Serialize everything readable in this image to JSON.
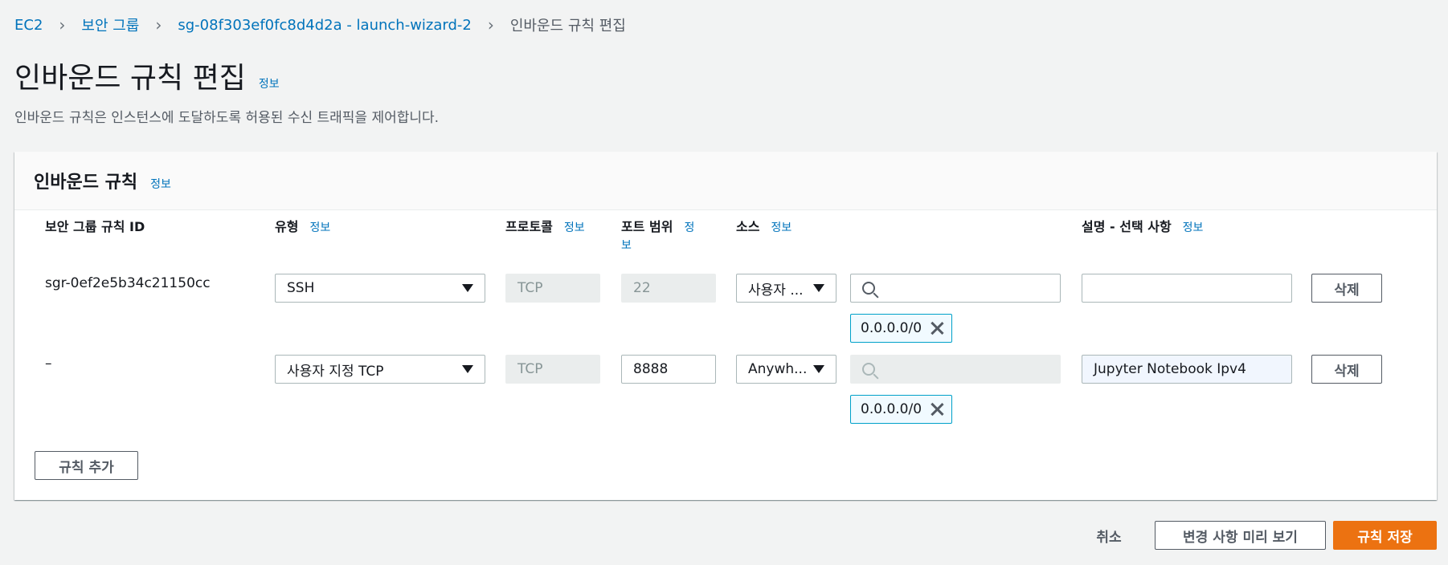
{
  "breadcrumb": {
    "items": [
      "EC2",
      "보안 그룹",
      "sg-08f303ef0fc8d4d2a - launch-wizard-2"
    ],
    "current": "인바운드 규칙 편집"
  },
  "page": {
    "title": "인바운드 규칙 편집",
    "info": "정보",
    "description": "인바운드 규칙은 인스턴스에 도달하도록 허용된 수신 트래픽을 제어합니다."
  },
  "panel": {
    "title": "인바운드 규칙",
    "info": "정보",
    "columns": {
      "rule_id": "보안 그룹 규칙 ID",
      "type": "유형",
      "protocol": "프로토콜",
      "port_range": "포트 범위",
      "port_range_info_1": "정",
      "port_range_info_2": "보",
      "source": "소스",
      "description": "설명 - 선택 사항",
      "info": "정보"
    },
    "rows": [
      {
        "rule_id": "sgr-0ef2e5b34c21150cc",
        "type": "SSH",
        "protocol": "TCP",
        "port_range": "22",
        "source_type": "사용자 ...",
        "source_search": "",
        "cidr": "0.0.0.0/0",
        "description": "",
        "delete": "삭제"
      },
      {
        "rule_id": "–",
        "type": "사용자 지정 TCP",
        "protocol": "TCP",
        "port_range": "8888",
        "source_type": "Anywh...",
        "source_search": "",
        "cidr": "0.0.0.0/0",
        "description": "Jupyter Notebook Ipv4",
        "delete": "삭제"
      }
    ],
    "add_rule": "규칙 추가"
  },
  "footer": {
    "cancel": "취소",
    "preview": "변경 사항 미리 보기",
    "save": "규칙 저장"
  }
}
